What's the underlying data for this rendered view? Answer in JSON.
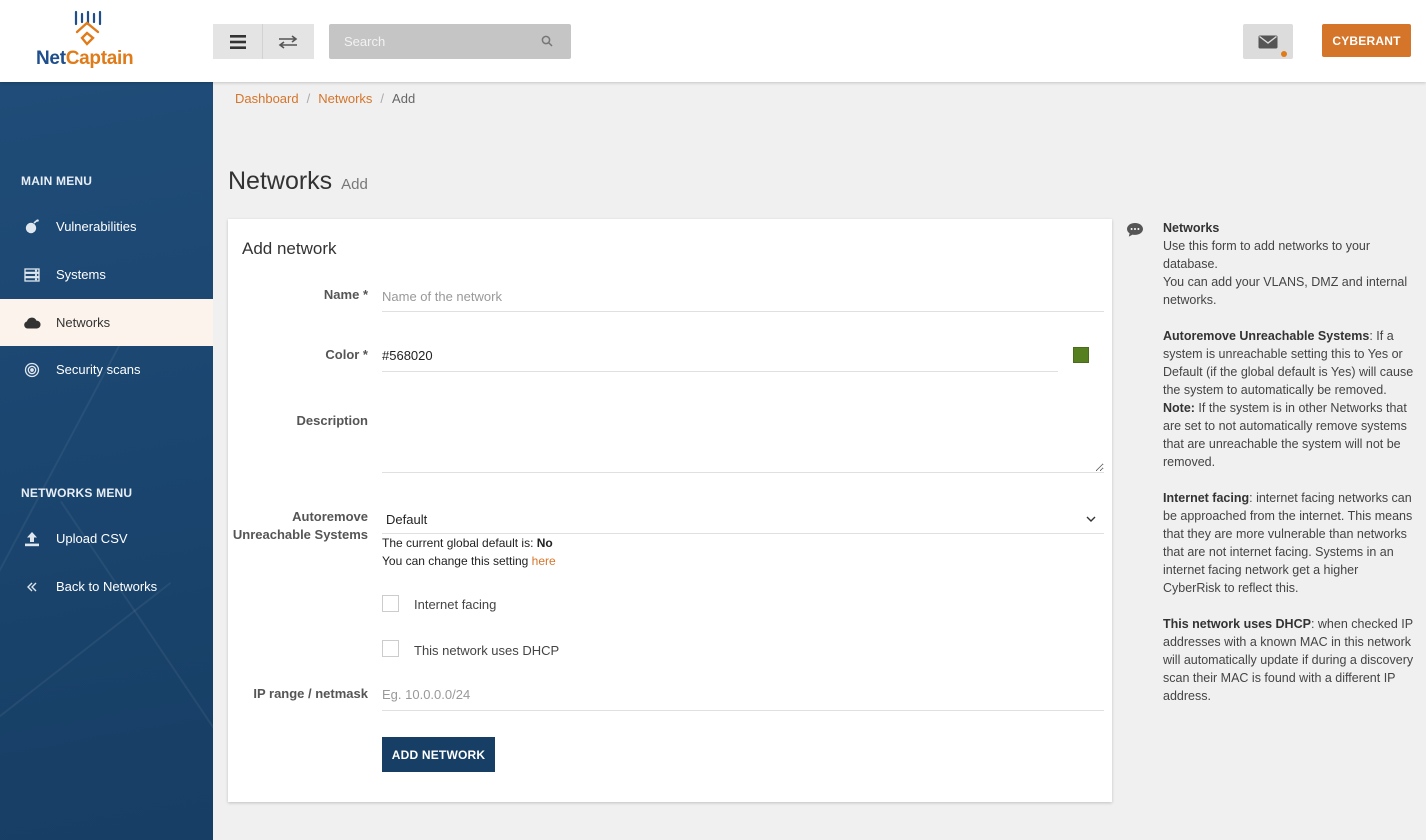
{
  "header": {
    "logo_text_a": "Net",
    "logo_text_b": "Captain",
    "search_placeholder": "Search",
    "user_label": "CYBERANT",
    "icons": {
      "menu": "hamburger-icon",
      "swap": "swap-icon",
      "search": "search-icon",
      "mail": "mail-icon"
    },
    "accent_color": "#d5752a",
    "brand_blue": "#1f4e8c"
  },
  "sidebar": {
    "main_menu_title": "MAIN MENU",
    "main_items": [
      {
        "label": "Vulnerabilities",
        "icon": "bug-icon"
      },
      {
        "label": "Systems",
        "icon": "server-icon"
      },
      {
        "label": "Networks",
        "icon": "cloud-icon",
        "active": true
      },
      {
        "label": "Security scans",
        "icon": "target-icon"
      }
    ],
    "networks_menu_title": "NETWORKS MENU",
    "network_items": [
      {
        "label": "Upload CSV",
        "icon": "upload-icon"
      },
      {
        "label": "Back to Networks",
        "icon": "double-chevron-left-icon"
      }
    ]
  },
  "breadcrumb": {
    "items": [
      "Dashboard",
      "Networks"
    ],
    "current": "Add",
    "separator": "/"
  },
  "page": {
    "title": "Networks",
    "subtitle": "Add"
  },
  "form": {
    "title": "Add network",
    "name_label": "Name *",
    "name_placeholder": "Name of the network",
    "name_value": "",
    "color_label": "Color *",
    "color_value": "#568020",
    "description_label": "Description",
    "description_value": "",
    "autoremove_label_1": "Autoremove",
    "autoremove_label_2": "Unreachable Systems",
    "autoremove_value": "Default",
    "global_default_text": "The current global default is: ",
    "global_default_value": "No",
    "change_setting_text": "You can change this setting ",
    "change_setting_link": "here",
    "internet_facing_label": "Internet facing",
    "internet_facing_checked": false,
    "dhcp_label": "This network uses DHCP",
    "dhcp_checked": false,
    "ip_label": "IP range / netmask",
    "ip_placeholder": "Eg. 10.0.0.0/24",
    "ip_value": "",
    "submit_label": "ADD NETWORK"
  },
  "help": {
    "icon": "chat-bubble-icon",
    "title": "Networks",
    "intro_1": "Use this form to add networks to your database.",
    "intro_2": "You can add your VLANS, DMZ and internal networks.",
    "autoremove_title": "Autoremove Unreachable Systems",
    "autoremove_text": ": If a system is unreachable setting this to Yes or Default (if the global default is Yes) will cause the system to automatically be removed.",
    "note_title": "Note:",
    "note_text": " If the system is in other Networks that are set to not automatically remove systems that are unreachable the system will not be removed.",
    "internet_title": "Internet facing",
    "internet_text": ": internet facing networks can be approached from the internet. This means that they are more vulnerable than networks that are not internet facing. Systems in an internet facing network get a higher CyberRisk to reflect this.",
    "dhcp_title": "This network uses DHCP",
    "dhcp_text": ": when checked IP addresses with a known MAC in this network will automatically update if during a discovery scan their MAC is found with a different IP address."
  }
}
